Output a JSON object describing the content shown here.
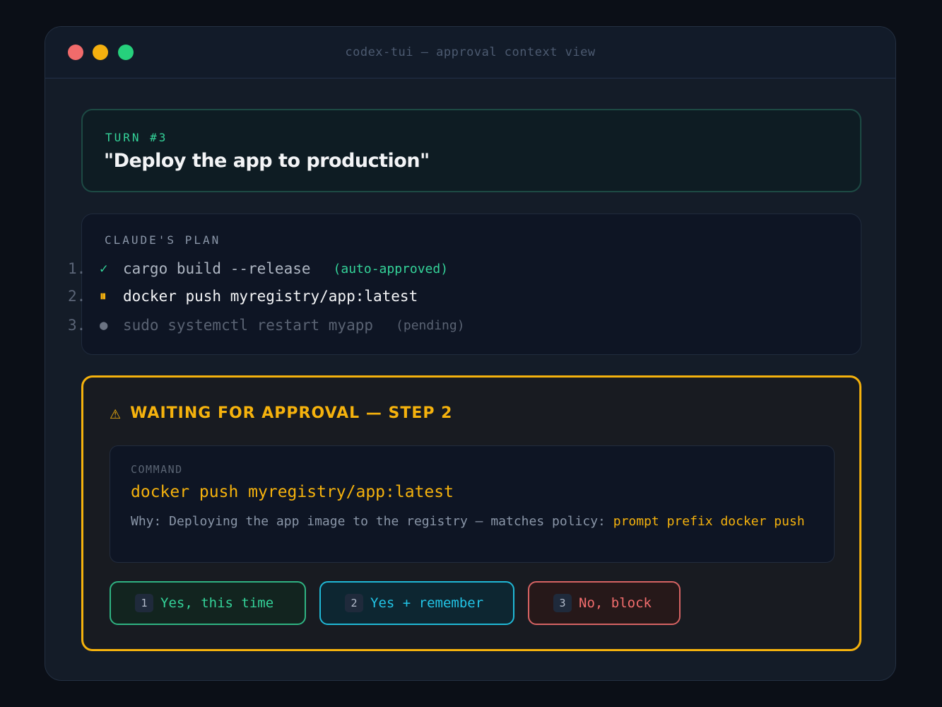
{
  "window": {
    "title": "codex-tui — approval context view"
  },
  "turn": {
    "label": "TURN #3",
    "prompt": "\"Deploy the app to production\""
  },
  "plan": {
    "label": "CLAUDE'S PLAN",
    "steps": [
      {
        "num": "1.",
        "icon": "✓",
        "icon_name": "check-icon",
        "command": "cargo build --release",
        "note": "(auto-approved)",
        "status": "approved"
      },
      {
        "num": "2.",
        "icon": "⏸",
        "icon_name": "pause-icon",
        "command": "docker push myregistry/app:latest",
        "note": "",
        "status": "waiting"
      },
      {
        "num": "3.",
        "icon": "●",
        "icon_name": "pending-dot-icon",
        "command": "sudo systemctl restart myapp",
        "note": "(pending)",
        "status": "pending"
      }
    ]
  },
  "approval": {
    "heading": "WAITING FOR APPROVAL — STEP 2",
    "warn_icon": "⚠",
    "command_label": "COMMAND",
    "command": "docker push myregistry/app:latest",
    "why_prefix": "Why: Deploying the app image to the registry — matches policy: ",
    "why_policy": "prompt prefix docker push",
    "buttons": [
      {
        "key": "1",
        "label": "Yes, this time"
      },
      {
        "key": "2",
        "label": "Yes + remember"
      },
      {
        "key": "3",
        "label": "No, block"
      }
    ]
  },
  "colors": {
    "accent_amber": "#f5b20d",
    "approve_green": "#34d399",
    "remember_cyan": "#22c4e6",
    "block_red": "#f26d6d",
    "background": "#0b0f17"
  }
}
